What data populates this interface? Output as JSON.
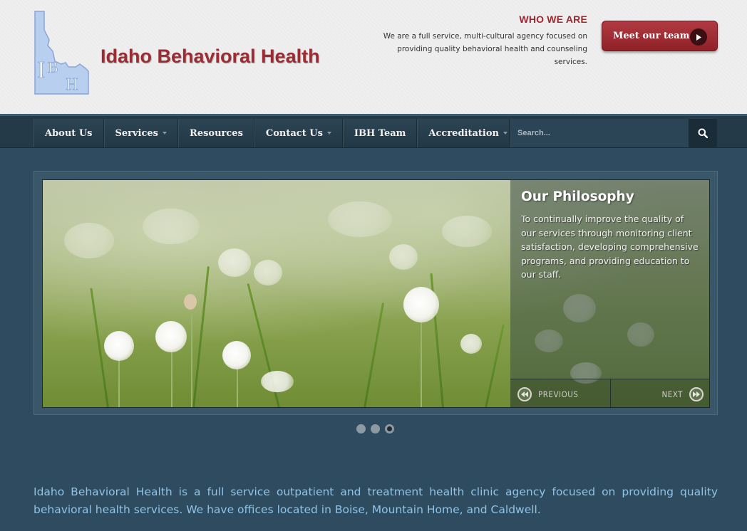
{
  "header": {
    "logo_letters": "IBH",
    "site_title": "Idaho Behavioral Health",
    "who_title": "WHO WE ARE",
    "who_text": "We are a full service, multi-cultural agency focused on providing quality behavioral health and counseling services.",
    "meet_button": "Meet our team"
  },
  "nav": {
    "items": [
      {
        "label": "About Us"
      },
      {
        "label": "Services"
      },
      {
        "label": "Resources"
      },
      {
        "label": "Contact Us"
      },
      {
        "label": "IBH Team"
      },
      {
        "label": "Accreditation"
      }
    ],
    "search_placeholder": "Search..."
  },
  "slider": {
    "caption_title": "Our Philosophy",
    "caption_text": "To continually improve the quality of our services through monitoring client satisfaction, developing comprehensive programs, and providing education to our staff.",
    "prev_label": "PREVIOUS",
    "next_label": "NEXT",
    "active_slide": 3,
    "slide_count": 3
  },
  "intro_text": "Idaho Behavioral Health is a full service outpatient and treatment health clinic agency focused on providing quality behavioral health services. We have offices located in Boise, Mountain Home, and Caldwell.",
  "colors": {
    "brand_red": "#9b2c33",
    "nav_bg": "#243a49",
    "page_bg": "#2f4b5f",
    "intro_text": "#8fc3e6"
  }
}
